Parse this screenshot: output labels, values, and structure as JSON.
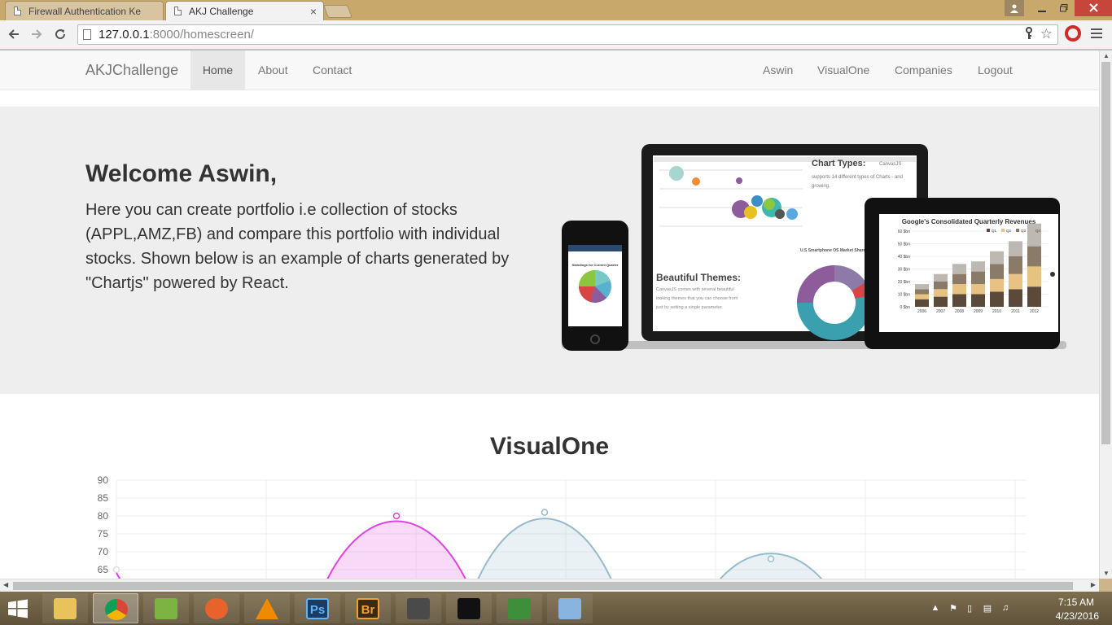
{
  "browser": {
    "tabs": [
      {
        "title": "Firewall Authentication Ke",
        "active": false
      },
      {
        "title": "AKJ Challenge",
        "active": true
      }
    ],
    "close_glyph": "×",
    "url_host": "127.0.0.1",
    "url_rest": ":8000/homescreen/"
  },
  "navbar": {
    "brand": "AKJChallenge",
    "left_links": [
      "Home",
      "About",
      "Contact"
    ],
    "right_links": [
      "Aswin",
      "VisualOne",
      "Companies",
      "Logout"
    ],
    "active": "Home"
  },
  "jumbotron": {
    "heading": "Welcome Aswin,",
    "lead": "Here you can create portfolio i.e collection of stocks (APPL,AMZ,FB) and compare this portfolio with individual stocks. Shown below is an example of charts generated by \"Chartjs\" powered by React.",
    "device_image_text": {
      "laptop_heading": "Chart Types:",
      "laptop_sub": "supports 14 different types of Charts - and growing.",
      "laptop_brand": "CanvasJS",
      "laptop_themes_title": "Beautiful Themes:",
      "laptop_themes_text": "CanvasJS comes with several beautiful looking themes that you can choose from just by setting a single parameter.",
      "laptop_pie_title": "U.S Smartphone OS Market Share, Q3",
      "tablet_title": "Google's Consolidated Quarterly Revenues",
      "tablet_legend": [
        "Q1",
        "Q2",
        "Q3",
        "Q4"
      ],
      "tablet_years": [
        "2006",
        "2007",
        "2008",
        "2009",
        "2010",
        "2011",
        "2012"
      ],
      "tablet_yticks": [
        "60 $bn",
        "50 $bn",
        "40 $bn",
        "30 $bn",
        "20 $bn",
        "10 $bn",
        "0 $bn"
      ],
      "phone_title": "Standings for Current Quarter"
    }
  },
  "chart_section": {
    "title": "VisualOne"
  },
  "chart_data": {
    "type": "line",
    "title": "",
    "ylim": [
      65,
      90
    ],
    "yticks": [
      90,
      85,
      80,
      75,
      70,
      65
    ],
    "grid": true,
    "series": [
      {
        "color": "#dd44dd",
        "fill": "rgba(221,68,221,0.2)",
        "points": [
          [
            0,
            65
          ],
          [
            2,
            80
          ]
        ]
      },
      {
        "color": "#97bbcd",
        "fill": "rgba(151,187,205,0.2)",
        "points": [
          [
            3,
            81
          ],
          [
            5,
            68
          ]
        ]
      }
    ]
  },
  "taskbar": {
    "time": "7:15 AM",
    "date": "4/23/2016",
    "apps": [
      {
        "name": "file-explorer",
        "color": "#e8c25a"
      },
      {
        "name": "chrome",
        "color": "#4c8bf5"
      },
      {
        "name": "android-studio",
        "color": "#7cb342"
      },
      {
        "name": "firefox",
        "color": "#e8632b"
      },
      {
        "name": "vlc",
        "color": "#f08a00"
      },
      {
        "name": "photoshop",
        "color": "#1d3a5f"
      },
      {
        "name": "bridge",
        "color": "#3b2a12"
      },
      {
        "name": "sublime-text",
        "color": "#4a4a4a"
      },
      {
        "name": "command-prompt",
        "color": "#111111"
      },
      {
        "name": "notepad",
        "color": "#3f8f3a"
      },
      {
        "name": "paint",
        "color": "#8ab4e0"
      }
    ],
    "ps_label": "Ps",
    "br_label": "Br"
  }
}
